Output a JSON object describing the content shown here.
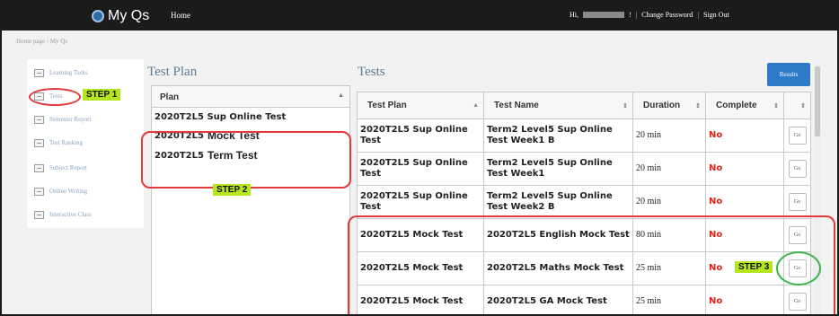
{
  "header": {
    "app_name": "My Qs",
    "nav_home": "Home",
    "user_greeting": "Hi,",
    "user_suffix": "!",
    "change_password": "Change Password",
    "sign_out": "Sign Out",
    "separator": "|"
  },
  "breadcrumb": "Home page › My Qs",
  "sidebar": {
    "items": [
      {
        "label": "Learning Tasks"
      },
      {
        "label": "Tests"
      },
      {
        "label": "Semester Report"
      },
      {
        "label": "Test Ranking"
      },
      {
        "label": "Subject Report"
      },
      {
        "label": "Online Writing"
      },
      {
        "label": "Interactive Class"
      }
    ]
  },
  "test_plan": {
    "title": "Test Plan",
    "column": "Plan",
    "rows": [
      {
        "code": "2020T2L5",
        "name": "Sup Online Test"
      },
      {
        "code": "2020T2L5",
        "name": "Mock Test"
      },
      {
        "code": "2020T2L5",
        "name": "Term Test"
      }
    ]
  },
  "tests": {
    "title": "Tests",
    "results_label": "Results",
    "columns": [
      "Test Plan",
      "Test Name",
      "Duration",
      "Complete"
    ],
    "go_label": "Go",
    "rows": [
      {
        "plan": "2020T2L5 Sup Online Test",
        "name": "Term2 Level5 Sup Online Test Week1 B",
        "duration": "20 min",
        "complete": "No"
      },
      {
        "plan": "2020T2L5 Sup Online Test",
        "name": "Term2 Level5 Sup Online Test Week1",
        "duration": "20 min",
        "complete": "No"
      },
      {
        "plan": "2020T2L5 Sup Online Test",
        "name": "Term2 Level5 Sup Online Test Week2 B",
        "duration": "20 min",
        "complete": "No"
      },
      {
        "plan": "2020T2L5 Mock Test",
        "name": "2020T2L5 English Mock Test",
        "duration": "80 min",
        "complete": "No"
      },
      {
        "plan": "2020T2L5 Mock Test",
        "name": "2020T2L5 Maths Mock Test",
        "duration": "25 min",
        "complete": "No"
      },
      {
        "plan": "2020T2L5 Mock Test",
        "name": "2020T2L5 GA Mock Test",
        "duration": "25 min",
        "complete": "No"
      }
    ]
  },
  "annotations": {
    "step1": "STEP 1",
    "step2": "STEP 2",
    "step3": "STEP 3",
    "step_color": "#b5e61d",
    "circle_red": "#e23a3a",
    "circle_green": "#3bb44a"
  }
}
